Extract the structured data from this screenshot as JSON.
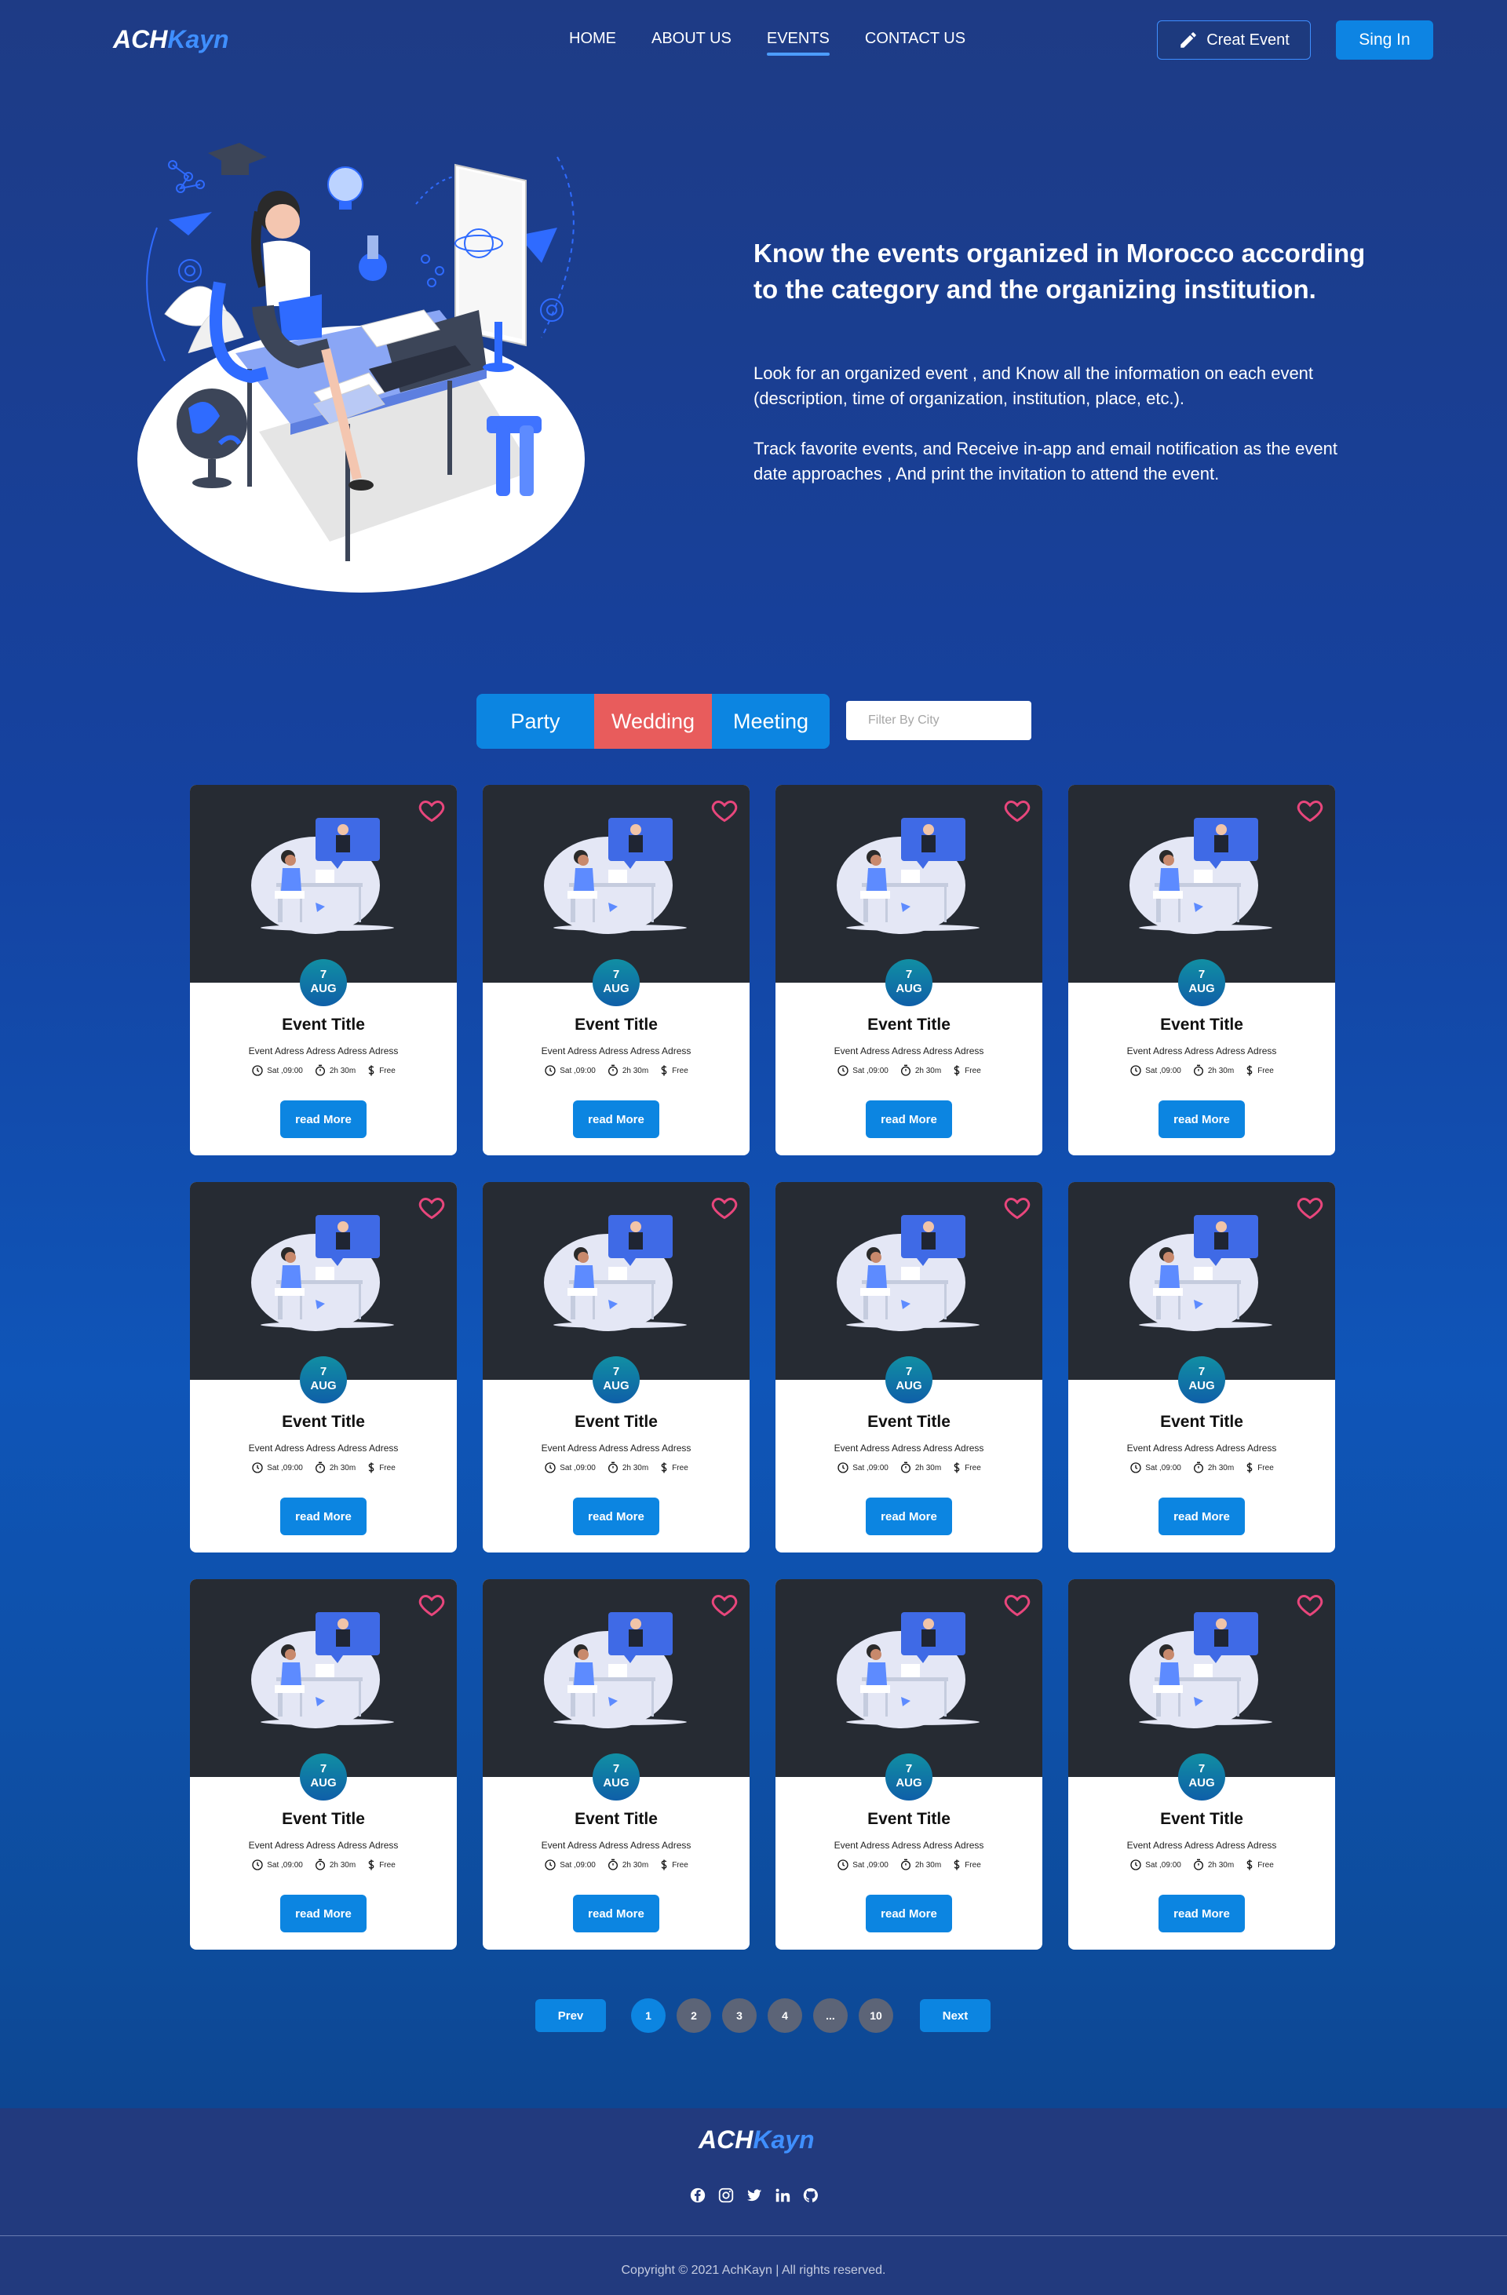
{
  "nav": {
    "logo_a": "ACH",
    "logo_b": "Kayn",
    "links": [
      "HOME",
      "ABOUT US",
      "EVENTS",
      "CONTACT US"
    ],
    "active_link": "EVENTS",
    "create_label": "Creat Event",
    "signin_label": "Sing In"
  },
  "hero": {
    "title": "Know the events organized in Morocco according to the category and the organizing institution.",
    "p1": "Look for an organized event , and Know all the information on each event (description, time of organization, institution, place, etc.).",
    "p2": "Track favorite events, and Receive in-app and email notification as the event date approaches , And print the invitation to attend the event."
  },
  "filter": {
    "party": "Party",
    "wedding": "Wedding",
    "meeting": "Meeting",
    "city_placeholder": "Filter By City"
  },
  "event": {
    "day": "7",
    "month": "AUG",
    "title": "Event Title",
    "address": "Event Adress Adress Adress Adress",
    "time": "Sat ,09:00",
    "duration": "2h 30m",
    "price": "Free",
    "button": "read More"
  },
  "pagination": {
    "prev": "Prev",
    "next": "Next",
    "pages": [
      "1",
      "2",
      "3",
      "4",
      "...",
      "10"
    ],
    "active": "1"
  },
  "footer": {
    "logo_a": "ACH",
    "logo_b": "Kayn",
    "copyright": "Copyright © 2021 AchKayn | All rights reserved."
  },
  "colors": {
    "accent": "#0c85e1",
    "wedding": "#e85c5c",
    "card_image_bg": "#262b33",
    "heart": "#e8467c"
  }
}
